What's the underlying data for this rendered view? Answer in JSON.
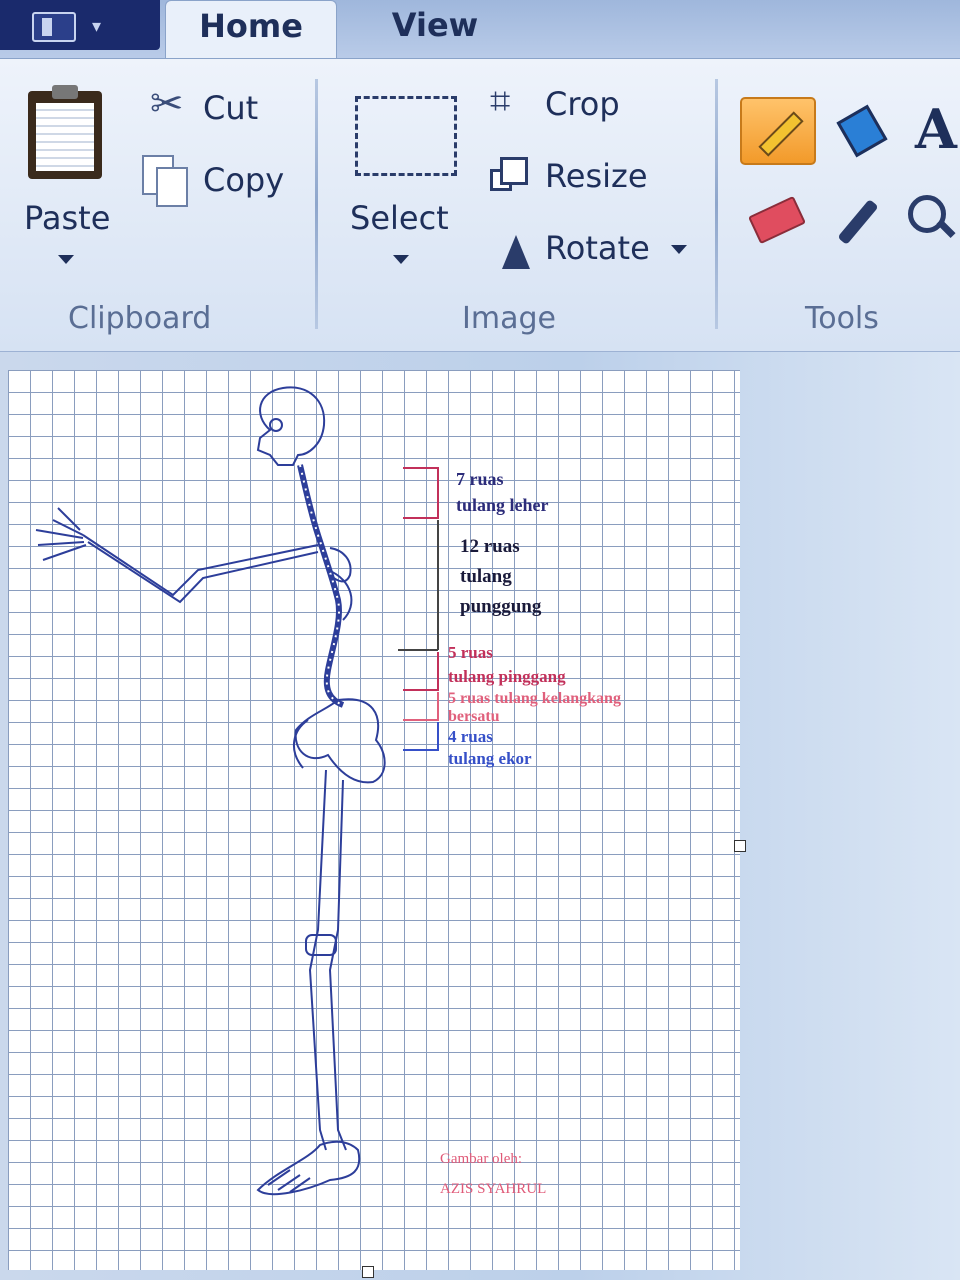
{
  "tabs": {
    "home": "Home",
    "view": "View"
  },
  "clipboard": {
    "paste": "Paste",
    "cut": "Cut",
    "copy": "Copy",
    "group_label": "Clipboard"
  },
  "image": {
    "select": "Select",
    "crop": "Crop",
    "resize": "Resize",
    "rotate": "Rotate",
    "group_label": "Image"
  },
  "tools": {
    "text_tool_glyph": "A",
    "group_label": "Tools",
    "active_tool": "pencil-icon"
  },
  "canvas": {
    "annotations": {
      "neck_count": "7 ruas",
      "neck_name": "tulang leher",
      "back_count": "12 ruas",
      "back_name_1": "tulang",
      "back_name_2": "punggung",
      "waist_count": "5 ruas",
      "waist_name": "tulang pinggang",
      "pelvis_1": "5 ruas tulang kelangkang",
      "pelvis_2": "bersatu",
      "tail_count": "4 ruas",
      "tail_name": "tulang ekor",
      "credit_1": "Gambar oleh:",
      "credit_2": "AZIS SYAHRUL"
    },
    "colors": {
      "line": "#2d3e9a",
      "neck": "#2c2c7a",
      "back": "#1a1a3a",
      "waist": "#c2305a",
      "pelvis": "#e0607c",
      "tail": "#3650c8",
      "credit": "#e05a78"
    }
  }
}
